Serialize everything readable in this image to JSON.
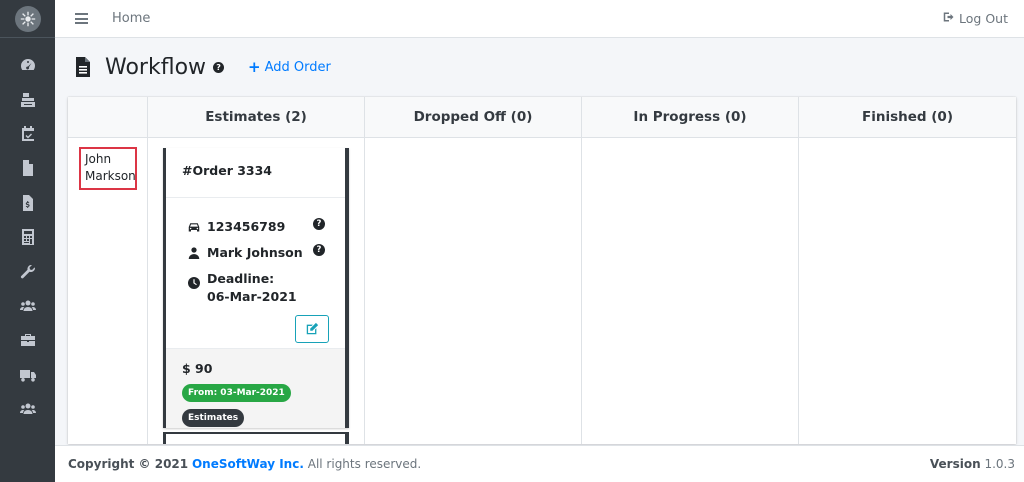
{
  "topbar": {
    "home_label": "Home",
    "logout_label": "Log Out"
  },
  "header": {
    "title": "Workflow",
    "help_glyph": "?",
    "add_order_label": "Add Order"
  },
  "sidebar": {
    "items": [
      {
        "icon": "dashboard-icon"
      },
      {
        "icon": "inventory-icon"
      },
      {
        "icon": "calendar-check-icon"
      },
      {
        "icon": "document-icon"
      },
      {
        "icon": "invoice-icon"
      },
      {
        "icon": "calculator-icon"
      },
      {
        "icon": "wrench-icon"
      },
      {
        "icon": "users-icon"
      },
      {
        "icon": "briefcase-icon"
      },
      {
        "icon": "truck-icon"
      },
      {
        "icon": "team-icon"
      }
    ]
  },
  "board": {
    "columns": [
      "Estimates (2)",
      "Dropped Off (0)",
      "In Progress (0)",
      "Finished (0)"
    ],
    "assignee": "John Markson"
  },
  "card": {
    "order": "#Order 3334",
    "vehicle": "123456789",
    "customer": "Mark Johnson",
    "deadline": "Deadline: 06-Mar-2021",
    "price": "$ 90",
    "from_badge": "From: 03-Mar-2021",
    "status_badge": "Estimates"
  },
  "footer": {
    "copyright_prefix": "Copyright © 2021",
    "company": "OneSoftWay Inc.",
    "rights": "All rights reserved.",
    "version_label": "Version",
    "version": "1.0.3"
  },
  "colors": {
    "accent": "#007bff",
    "sidebar": "#343a40",
    "highlight": "#dc3545",
    "success": "#28a745",
    "info": "#17a2b8"
  }
}
